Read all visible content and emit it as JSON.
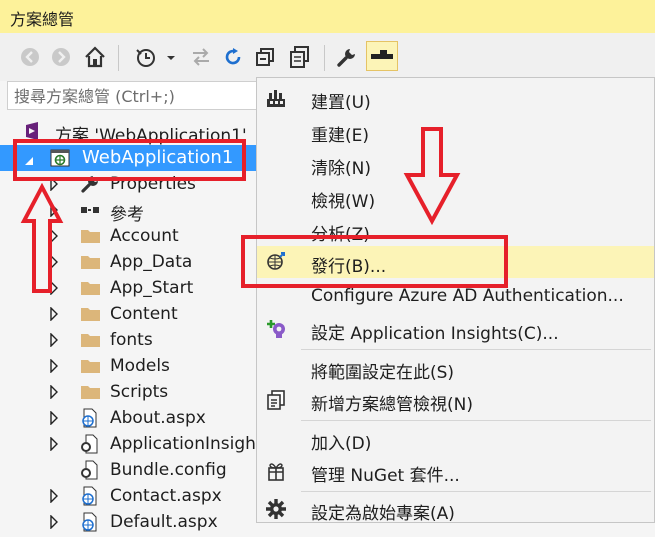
{
  "title": "方案總管",
  "search": {
    "placeholder": "搜尋方案總管 (Ctrl+;)"
  },
  "toolbar": {
    "icons": [
      "back-icon",
      "forward-icon",
      "home-icon",
      "history-icon",
      "sync-icon",
      "refresh-icon",
      "collapse-icon",
      "copy-icon",
      "properties-icon",
      "preview-icon"
    ]
  },
  "tree": {
    "items": [
      {
        "label": "方案 'WebApplication1'",
        "icon": "solution-icon"
      },
      {
        "label": "WebApplication1",
        "icon": "project-icon"
      },
      {
        "label": "Properties",
        "icon": "wrench-icon"
      },
      {
        "label": "參考",
        "icon": "references-icon"
      },
      {
        "label": "Account",
        "icon": "folder-icon"
      },
      {
        "label": "App_Data",
        "icon": "folder-icon"
      },
      {
        "label": "App_Start",
        "icon": "folder-icon"
      },
      {
        "label": "Content",
        "icon": "folder-icon"
      },
      {
        "label": "fonts",
        "icon": "folder-icon"
      },
      {
        "label": "Models",
        "icon": "folder-icon"
      },
      {
        "label": "Scripts",
        "icon": "folder-icon"
      },
      {
        "label": "About.aspx",
        "icon": "aspx-file-icon"
      },
      {
        "label": "ApplicationInsigh",
        "icon": "config-file-icon"
      },
      {
        "label": "Bundle.config",
        "icon": "config-file-icon"
      },
      {
        "label": "Contact.aspx",
        "icon": "aspx-file-icon"
      },
      {
        "label": "Default.aspx",
        "icon": "aspx-file-icon"
      }
    ]
  },
  "menu": {
    "items": [
      {
        "label": "建置(U)",
        "icon": "build-icon"
      },
      {
        "label": "重建(E)"
      },
      {
        "label": "清除(N)"
      },
      {
        "label": "檢視(W)"
      },
      {
        "label": "分析(Z)"
      },
      {
        "label": "發行(B)...",
        "icon": "publish-icon"
      },
      {
        "label": "Configure Azure AD Authentication..."
      },
      {
        "label": "設定 Application Insights(C)...",
        "icon": "app-insights-icon"
      },
      {
        "label": "將範圍設定在此(S)"
      },
      {
        "label": "新增方案總管檢視(N)",
        "icon": "new-view-icon"
      },
      {
        "label": "加入(D)"
      },
      {
        "label": "管理 NuGet 套件...",
        "icon": "nuget-icon"
      },
      {
        "label": "設定為啟始專案(A)",
        "icon": "gear-icon"
      }
    ]
  },
  "colors": {
    "title_bg": "#fdf29a",
    "selection": "#3399ff",
    "highlight": "#fcf4b7",
    "annotation": "#e6202a"
  }
}
